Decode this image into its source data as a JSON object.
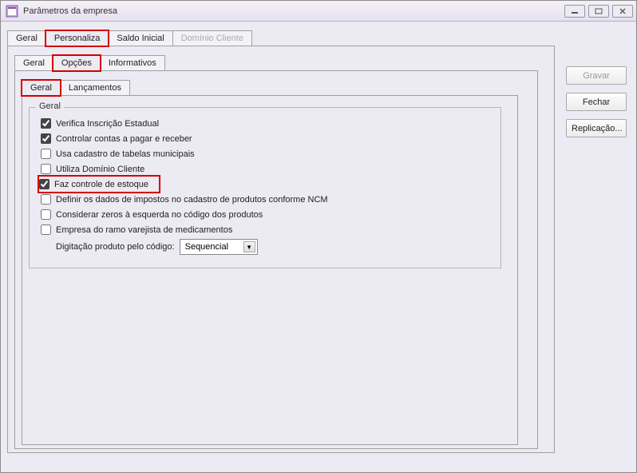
{
  "window": {
    "title": "Parâmetros da empresa"
  },
  "sideButtons": {
    "save": "Gravar",
    "close": "Fechar",
    "replicate": "Replicação..."
  },
  "tabsLevel1": {
    "geral": "Geral",
    "personaliza": "Personaliza",
    "saldo": "Saldo Inicial",
    "dominio": "Domínio Cliente"
  },
  "tabsLevel2": {
    "geral": "Geral",
    "opcoes": "Opções",
    "informativos": "Informativos"
  },
  "tabsLevel3": {
    "geral": "Geral",
    "lancamentos": "Lançamentos"
  },
  "fieldset": {
    "legend": "Geral",
    "items": {
      "verifica": {
        "label": "Verifica Inscrição Estadual",
        "checked": true
      },
      "controlar": {
        "label": "Controlar contas a pagar e receber",
        "checked": true
      },
      "cadastro": {
        "label": "Usa cadastro de tabelas municipais",
        "checked": false
      },
      "dominio": {
        "label": "Utiliza Domínio Cliente",
        "checked": false
      },
      "estoque": {
        "label": "Faz controle de estoque",
        "checked": true
      },
      "ncm": {
        "label": "Definir os dados de impostos no cadastro de produtos conforme NCM",
        "checked": false
      },
      "zeros": {
        "label": "Considerar zeros à esquerda no código dos produtos",
        "checked": false
      },
      "varejista": {
        "label": "Empresa do ramo varejista de medicamentos",
        "checked": false
      }
    },
    "dropdown": {
      "label": "Digitação produto pelo código:",
      "value": "Sequencial"
    }
  }
}
